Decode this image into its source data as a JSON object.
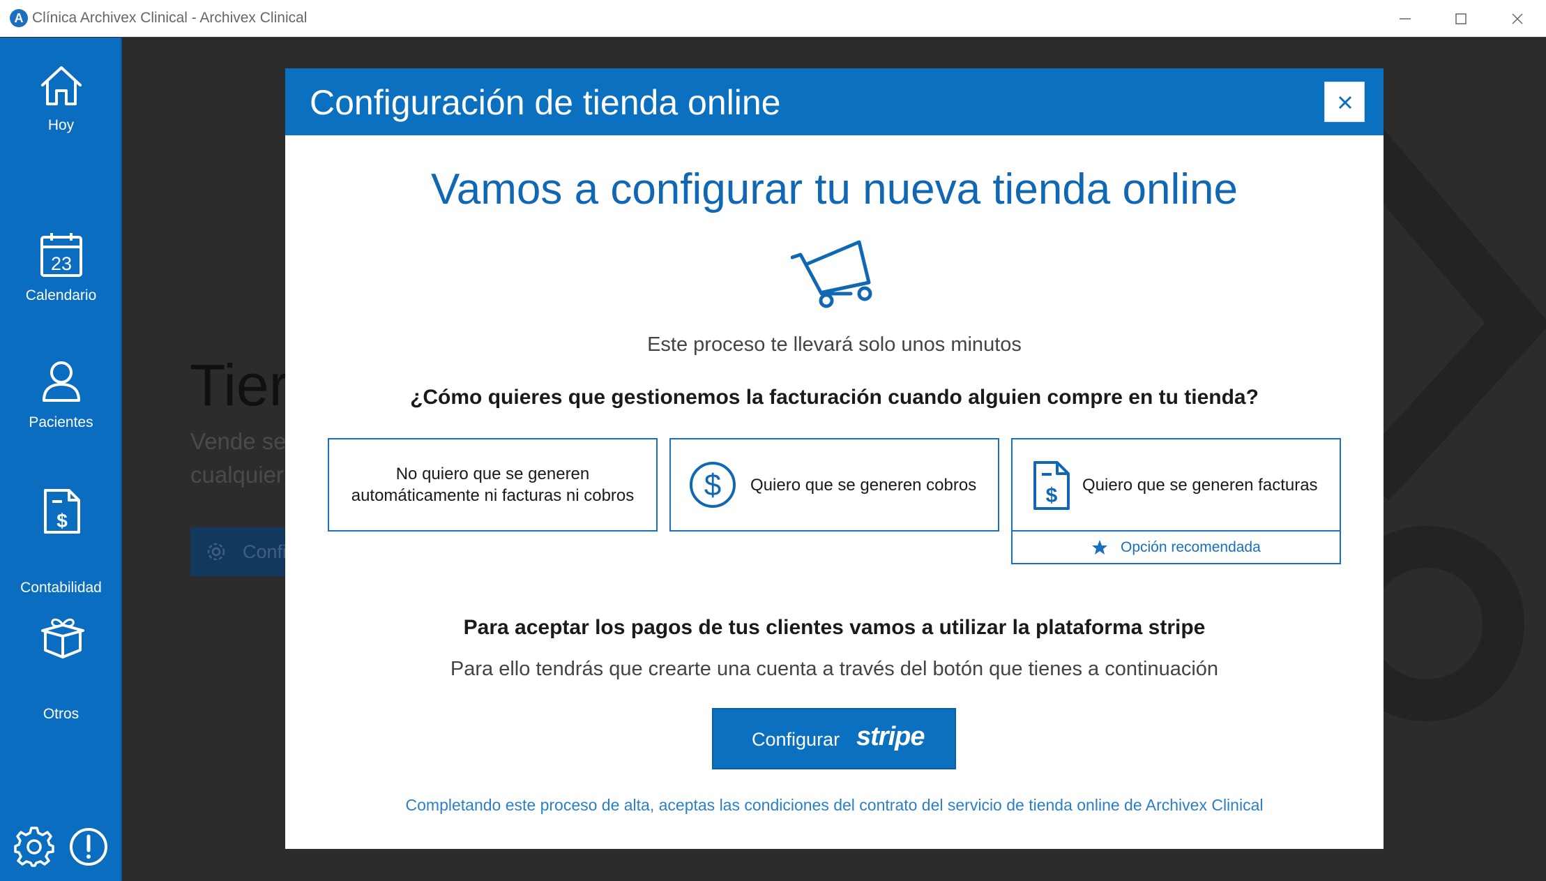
{
  "window": {
    "title": "Clínica Archivex Clinical - Archivex Clinical",
    "logo_letter": "A"
  },
  "sidebar": {
    "items": [
      {
        "label": "Hoy"
      },
      {
        "label": "Calendario",
        "day": "23"
      },
      {
        "label": "Pacientes"
      },
      {
        "label": "Contabilidad"
      },
      {
        "label": "Otros"
      }
    ]
  },
  "background": {
    "title": "Tier",
    "desc_line1": "Vende se",
    "desc_line2": "cualquier",
    "button_label": "Confi"
  },
  "modal": {
    "title": "Configuración de tienda online",
    "headline": "Vamos a configurar tu nueva tienda online",
    "subtitle": "Este proceso te llevará solo unos minutos",
    "question": "¿Cómo quieres que gestionemos la facturación cuando alguien compre en tu tienda?",
    "options": [
      {
        "line1": "No quiero que se generen",
        "line2": "automáticamente ni facturas ni cobros"
      },
      {
        "label": "Quiero que se generen cobros"
      },
      {
        "label": "Quiero que se generen facturas"
      }
    ],
    "recommended_label": "Opción recomendada",
    "stripe_heading": "Para aceptar los pagos de tus clientes vamos a utilizar la plataforma stripe",
    "stripe_sub": "Para ello tendrás que crearte una cuenta a través del botón que tienes a continuación",
    "stripe_button": {
      "label": "Configurar",
      "logo": "stripe"
    },
    "terms": "Completando este proceso de alta, aceptas las condiciones del contrato del servicio de tienda online de Archivex Clinical"
  }
}
